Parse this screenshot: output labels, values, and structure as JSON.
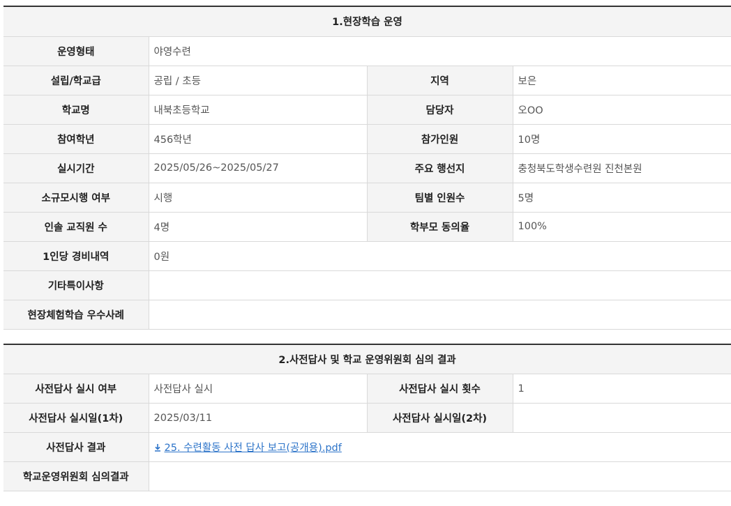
{
  "section1": {
    "title": "1.현장학습 운영",
    "rows": [
      {
        "label": "운영형태",
        "value": "야영수련"
      },
      {
        "label": "설립/학교급",
        "value": "공립 / 초등",
        "label2": "지역",
        "value2": "보은"
      },
      {
        "label": "학교명",
        "value": "내북초등학교",
        "label2": "담당자",
        "value2": "오OO"
      },
      {
        "label": "참여학년",
        "value": "456학년",
        "label2": "참가인원",
        "value2": "10명"
      },
      {
        "label": "실시기간",
        "value": "2025/05/26~2025/05/27",
        "label2": "주요 행선지",
        "value2": "충청북도학생수련원 진천본원"
      },
      {
        "label": "소규모시행 여부",
        "value": "시행",
        "label2": "팀별 인원수",
        "value2": "5명"
      },
      {
        "label": "인솔 교직원 수",
        "value": "4명",
        "label2": "학부모 동의율",
        "value2": "100%"
      },
      {
        "label": "1인당 경비내역",
        "value": "0원"
      },
      {
        "label": "기타특이사항",
        "value": ""
      },
      {
        "label": "현장체험학습 우수사례",
        "value": ""
      }
    ]
  },
  "section2": {
    "title": "2.사전답사 및 학교 운영위원회 심의 결과",
    "rows": [
      {
        "label": "사전답사 실시 여부",
        "value": "사전답사 실시",
        "label2": "사전답사 실시 횟수",
        "value2": "1"
      },
      {
        "label": "사전답사 실시일(1차)",
        "value": "2025/03/11",
        "label2": "사전답사 실시일(2차)",
        "value2": ""
      },
      {
        "label": "사전답사 결과",
        "value": "25. 수련활동 사전 답사 보고(공개용).pdf",
        "icon": "download-icon"
      },
      {
        "label": "학교운영위원회 심의결과",
        "value": ""
      }
    ]
  },
  "colors": {
    "header_bg": "#f4f4f4",
    "border": "#d9d9d9",
    "link": "#2d74c9"
  }
}
